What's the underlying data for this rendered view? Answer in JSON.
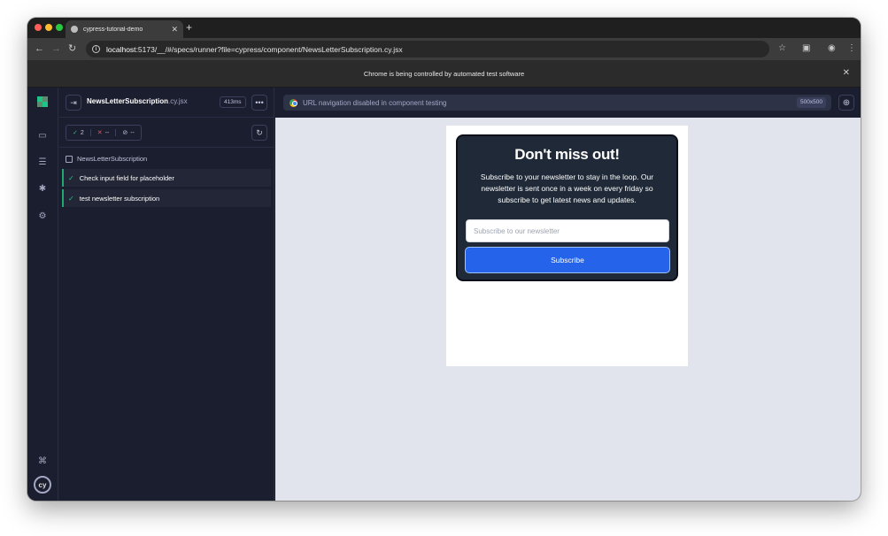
{
  "browser": {
    "tab_title": "cypress-tutorial-demo",
    "url_host": "localhost",
    "url_rest": ":5173/__/#/specs/runner?file=cypress/component/NewsLetterSubscription.cy.jsx",
    "automation_notice": "Chrome is being controlled by automated test software"
  },
  "reporter": {
    "spec_name": "NewsLetterSubscription",
    "spec_ext": ".cy.jsx",
    "duration": "413ms",
    "stats": {
      "passed": "2",
      "failed": "--",
      "pending": "--"
    },
    "suite_title": "NewsLetterSubscription",
    "tests": [
      {
        "title": "Check input field for placeholder",
        "state": "passed"
      },
      {
        "title": "test newsletter subscription",
        "state": "passed"
      }
    ]
  },
  "preview": {
    "url_message": "URL navigation disabled in component testing",
    "viewport": "500x500"
  },
  "component": {
    "title": "Don't miss out!",
    "description": "Subscribe to your newsletter to stay in the loop. Our newsletter is sent once in a week on every friday so subscribe to get latest news and updates.",
    "input_placeholder": "Subscribe to our newsletter",
    "button_label": "Subscribe"
  },
  "colors": {
    "pass": "#1fc287",
    "fail": "#e94f5f",
    "accent_button": "#2563eb",
    "card_bg": "#1f2937"
  },
  "icons": [
    "close-icon",
    "plus-icon",
    "back-arrow-icon",
    "forward-arrow-icon",
    "reload-icon",
    "info-icon",
    "star-icon",
    "tab-search-icon",
    "profile-icon",
    "more-vert-icon",
    "cypress-logo-icon",
    "specs-icon",
    "runs-icon",
    "debug-icon",
    "settings-icon",
    "keyboard-shortcuts-icon",
    "cy-logo-icon",
    "toggle-reporter-icon",
    "ellipsis-icon",
    "rerun-icon",
    "chrome-icon",
    "selector-playground-icon",
    "suite-icon",
    "check-icon"
  ]
}
